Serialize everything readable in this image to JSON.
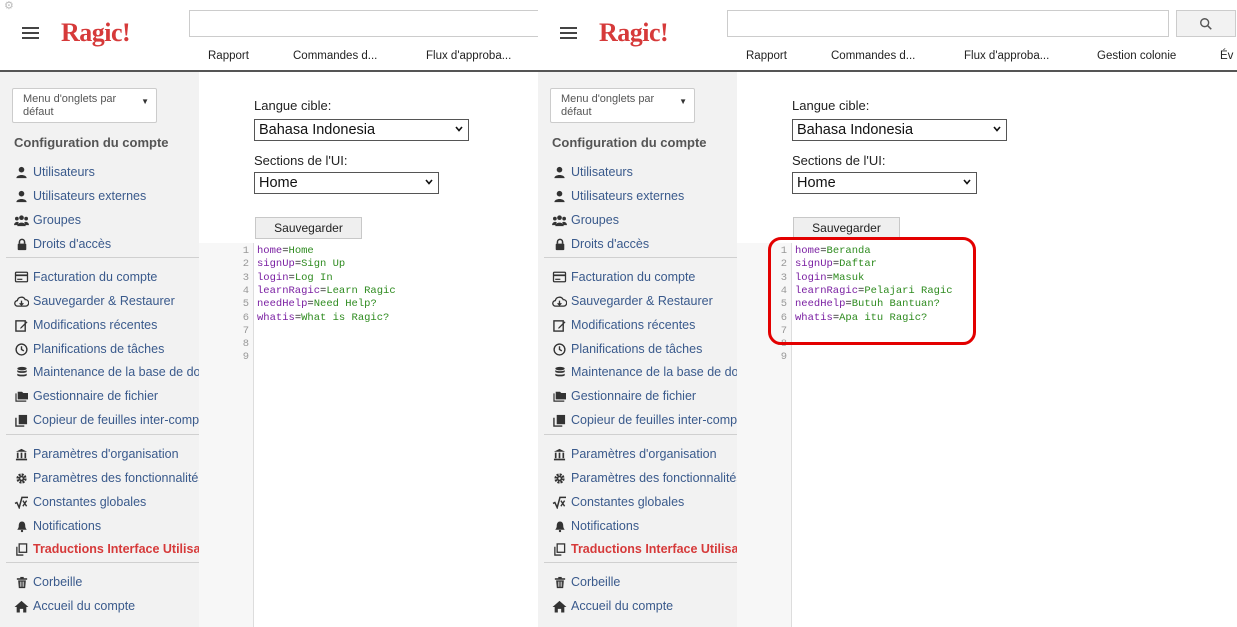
{
  "app": {
    "logo": "Ragic!"
  },
  "tabs_left": [
    "Rapport",
    "Commandes d...",
    "Flux d'approba..."
  ],
  "tabs_right": [
    "Rapport",
    "Commandes d...",
    "Flux d'approba...",
    "Gestion colonie",
    "Év"
  ],
  "sidebar": {
    "menu_select": "Menu d'onglets par défaut",
    "section_title": "Configuration du compte",
    "items": [
      {
        "label": "Utilisateurs",
        "icon": "user-icon"
      },
      {
        "label": "Utilisateurs externes",
        "icon": "user-icon"
      },
      {
        "label": "Groupes",
        "icon": "users-icon"
      },
      {
        "label": "Droits d'accès",
        "icon": "lock-icon"
      },
      {
        "label": "Facturation du compte",
        "icon": "billing-icon"
      },
      {
        "label": "Sauvegarder & Restaurer",
        "icon": "cloud-download-icon"
      },
      {
        "label": "Modifications récentes",
        "icon": "edit-icon"
      },
      {
        "label": "Planifications de tâches",
        "icon": "clock-icon"
      },
      {
        "label": "Maintenance de la base de données",
        "icon": "database-icon"
      },
      {
        "label": "Gestionnaire de fichier",
        "icon": "folder-icon"
      },
      {
        "label": "Copieur de feuilles inter-comptes",
        "icon": "copy-icon"
      },
      {
        "label": "Paramètres d'organisation",
        "icon": "bank-icon"
      },
      {
        "label": "Paramètres des fonctionnalités",
        "icon": "gear-icon"
      },
      {
        "label": "Constantes globales",
        "icon": "sqrt-icon"
      },
      {
        "label": "Notifications",
        "icon": "bell-icon"
      },
      {
        "label": "Traductions Interface Utilisateur",
        "icon": "duplicate-icon",
        "active": true
      },
      {
        "label": "Corbeille",
        "icon": "trash-icon"
      },
      {
        "label": "Accueil du compte",
        "icon": "home-icon"
      }
    ]
  },
  "form": {
    "target_language_label": "Langue cible:",
    "target_language_value": "Bahasa Indonesia",
    "ui_sections_label": "Sections de l'UI:",
    "ui_sections_value": "Home",
    "save_label": "Sauvegarder"
  },
  "editor_left": {
    "line_numbers": [
      "1",
      "2",
      "3",
      "4",
      "5",
      "6",
      "7",
      "8",
      "9"
    ],
    "lines": [
      {
        "key": "home",
        "value": "Home"
      },
      {
        "key": "signUp",
        "value": "Sign Up"
      },
      {
        "key": "login",
        "value": "Log In"
      },
      {
        "key": "learnRagic",
        "value": "Learn Ragic"
      },
      {
        "key": "needHelp",
        "value": "Need Help?"
      },
      {
        "key": "whatis",
        "value": "What is Ragic?"
      }
    ]
  },
  "editor_right": {
    "line_numbers": [
      "1",
      "2",
      "3",
      "4",
      "5",
      "6",
      "7",
      "8",
      "9"
    ],
    "lines": [
      {
        "key": "home",
        "value": "Beranda"
      },
      {
        "key": "signUp",
        "value": "Daftar"
      },
      {
        "key": "login",
        "value": "Masuk"
      },
      {
        "key": "learnRagic",
        "value": "Pelajari Ragic"
      },
      {
        "key": "needHelp",
        "value": "Butuh Bantuan?"
      },
      {
        "key": "whatis",
        "value": "Apa itu Ragic?"
      }
    ]
  },
  "colors": {
    "brand": "#d63a3a",
    "link": "#3a5a8c",
    "highlight": "#e30000"
  }
}
